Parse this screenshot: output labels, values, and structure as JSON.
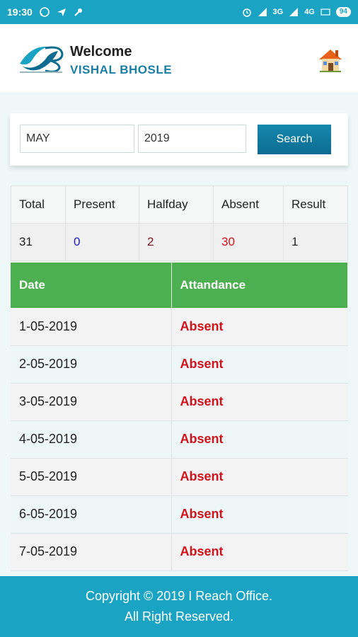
{
  "status_bar": {
    "time": "19:30",
    "network_label": "3G",
    "network_label_2": "4G",
    "battery": "94",
    "icons": [
      "whatsapp-icon",
      "airplane-icon",
      "wrench-icon",
      "alarm-icon",
      "signal-icon",
      "signal-icon",
      "volte-icon",
      "battery-icon"
    ]
  },
  "header": {
    "welcome": "Welcome",
    "user_name": "VISHAL BHOSLE",
    "home_icon": "home-icon",
    "logo_icon": "company-logo"
  },
  "search": {
    "month_value": "MAY",
    "year_value": "2019",
    "button_label": "Search"
  },
  "summary": {
    "headers": [
      "Total",
      "Present",
      "Halfday",
      "Absent",
      "Result"
    ],
    "values": [
      "31",
      "0",
      "2",
      "30",
      "1"
    ],
    "colors": [
      "#222222",
      "#1a1ad6",
      "#7a1a1a",
      "#d0131b",
      "#222222"
    ]
  },
  "attendance": {
    "headers": [
      "Date",
      "Attandance"
    ],
    "rows": [
      {
        "date": "1-05-2019",
        "status": "Absent"
      },
      {
        "date": "2-05-2019",
        "status": "Absent"
      },
      {
        "date": "3-05-2019",
        "status": "Absent"
      },
      {
        "date": "4-05-2019",
        "status": "Absent"
      },
      {
        "date": "5-05-2019",
        "status": "Absent"
      },
      {
        "date": "6-05-2019",
        "status": "Absent"
      },
      {
        "date": "7-05-2019",
        "status": "Absent"
      }
    ]
  },
  "footer": {
    "line1": "Copyright © 2019 I Reach Office.",
    "line2": "All Right Reserved."
  },
  "colors": {
    "primary": "#1ba3c4",
    "button": "#0e6c91",
    "table_header": "#4cb050",
    "absent": "#d0131b"
  }
}
